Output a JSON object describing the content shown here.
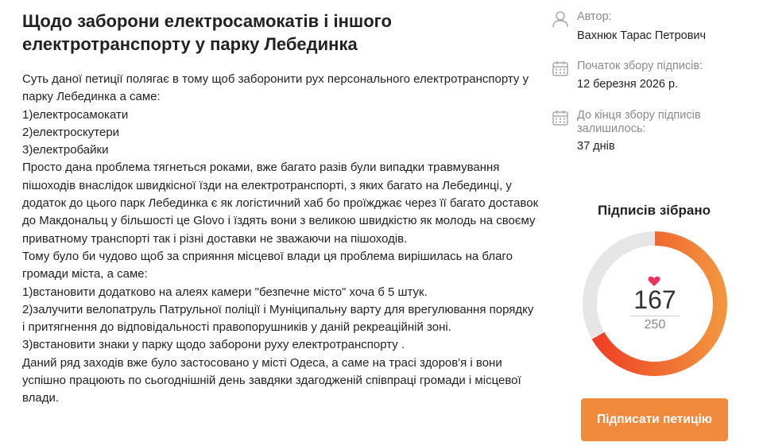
{
  "petition": {
    "title": "Щодо заборони електросамокатів і іншого електротранспорту у парку Лебединка",
    "body": [
      "Суть даної петиції полягає в тому щоб заборонити рух персонального електротранспорту у парку Лебединка а саме:",
      "1)електросамокати",
      "2)електроскутери",
      "3)електробайки",
      "Просто дана проблема тягнеться роками, вже багато разів були випадки травмування пішоходів внаслідок швидкісної їзди на електротранспорті, з яких багато на Лебединці, у додаток до цього парк Лебединка є як логістичний хаб бо проїжджає через її багато доставок до Макдональц у більшості це Glovo і їздять вони з великою швидкістю як молодь на своєму приватному транспорті так і різні доставки не зважаючи на пішоходів.",
      "Тому було би чудово щоб за сприяння місцевої влади ця проблема вирішилась на благо громади міста, а саме:",
      "1)встановити додатково на алеях камери \"безпечне місто\" хоча б 5 штук.",
      "2)залучити велопатруль Патрульної поліції і Муніципальну варту для врегулювання порядку і притягнення до відповідальності правопорушників у даній рекреаційній зоні.",
      "3)встановити знаки у парку щодо заборони руху електротранспорту .",
      "Даний ряд заходів вже було застосовано у місті Одеса, а саме на трасі здоров'я і вони успішно працюють по сьогоднішній день завдяки здагодженій співпраці громади і місцевої влади."
    ]
  },
  "sidebar": {
    "author_label": "Автор:",
    "author_name": "Вахнюк Тарас Петрович",
    "start_label": "Початок збору підписів:",
    "start_date": "12 березня 2026 р.",
    "remaining_label": "До кінця збору підписів залишилось:",
    "remaining_value": "37 днів",
    "collected_title": "Підписів зібрано",
    "signatures": 167,
    "goal": 250,
    "sign_button": "Підписати петицію",
    "icons": [
      "user-icon",
      "calendar-icon",
      "calendar-icon",
      "heart-icon"
    ],
    "colors": {
      "accent": "#f08a3c",
      "progress_start": "#ef3b24",
      "progress_end": "#f28a3a",
      "track": "#e6e6e6",
      "heart": "#e8345c"
    }
  }
}
